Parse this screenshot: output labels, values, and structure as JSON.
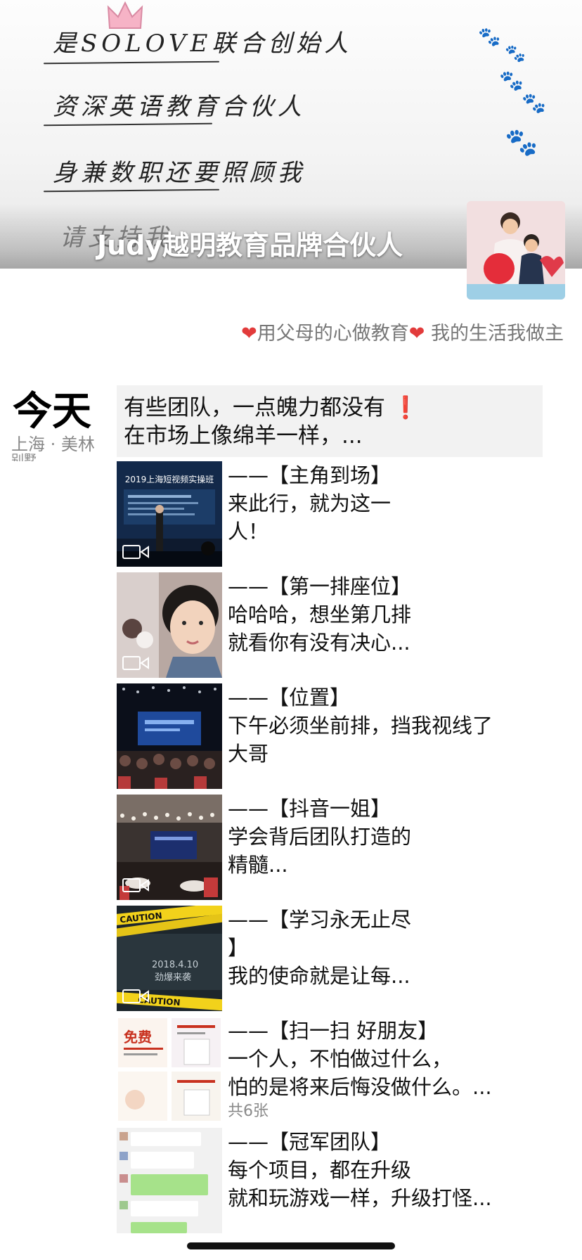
{
  "cover": {
    "handwriting_lines": [
      "是SOLOVE联合创始人",
      "资深英语教育合伙人",
      "身兼数职还要照顾我"
    ],
    "handwriting_faint": "请支持我",
    "nickname": "Judy越明教育品牌合伙人"
  },
  "profile": {
    "signature_parts": [
      "用父母的心做教育",
      "我的生活我做主"
    ],
    "heart_glyph": "❤"
  },
  "date": {
    "day": "今天",
    "location": "上海 · 美林",
    "location_cut": "别墅"
  },
  "text_post": {
    "line1": "有些团队，一点魄力都没有",
    "exclaim": "❗",
    "line2": "在市场上像绵羊一样，..."
  },
  "posts": [
    {
      "lines": [
        "——【主角到场】",
        "来此行，就为这一",
        "人！"
      ],
      "video": true,
      "thumb": "stage-speaker",
      "top_label": "2019上海短视频实操班"
    },
    {
      "lines": [
        "——【第一排座位】",
        "哈哈哈，想坐第几排",
        "就看你有没有决心..."
      ],
      "video": true,
      "thumb": "selfie"
    },
    {
      "lines": [
        "——【位置】",
        "下午必须坐前排，挡我视线了",
        "大哥"
      ],
      "video": false,
      "thumb": "conference-hall"
    },
    {
      "lines": [
        "——【抖音一姐】",
        "学会背后团队打造的",
        "精髓..."
      ],
      "video": true,
      "thumb": "banquet-hall"
    },
    {
      "lines": [
        "——【学习永无止尽",
        "】",
        "我的使命就是让每..."
      ],
      "video": true,
      "thumb": "caution-poster",
      "poster_text": [
        "2018.4.10",
        "劲爆来袭"
      ],
      "tape_text": "CAUTION"
    },
    {
      "lines": [
        "——【扫一扫 好朋友】",
        "一个人，不怕做过什么，",
        "怕的是将来后悔没做什么。..."
      ],
      "video": false,
      "thumb": "flyer-grid",
      "count": "共6张",
      "flyer_text": "免费"
    },
    {
      "lines": [
        "——【冠军团队】",
        "每个项目，都在升级",
        "就和玩游戏一样，升级打怪..."
      ],
      "video": false,
      "thumb": "chat-screenshot"
    }
  ]
}
